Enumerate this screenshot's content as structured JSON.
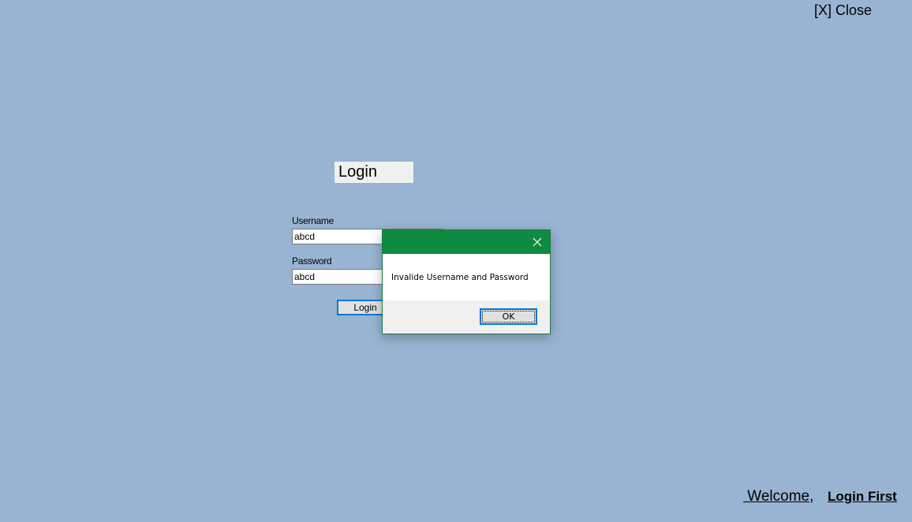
{
  "header": {
    "close_label": "[X] Close"
  },
  "login_form": {
    "title": "Login",
    "username_label": "Username",
    "username_value": "abcd",
    "password_label": "Password",
    "password_value": "abcd",
    "login_button_label": "Login"
  },
  "dialog": {
    "message": "Invalide Username and Password",
    "ok_label": "OK",
    "close_icon": "close-icon",
    "titlebar_color": "#0f8a41"
  },
  "footer": {
    "welcome_label": " Welcome,",
    "login_first_label": "Login First"
  },
  "colors": {
    "background": "#98b4d2",
    "accent": "#0078d7"
  }
}
